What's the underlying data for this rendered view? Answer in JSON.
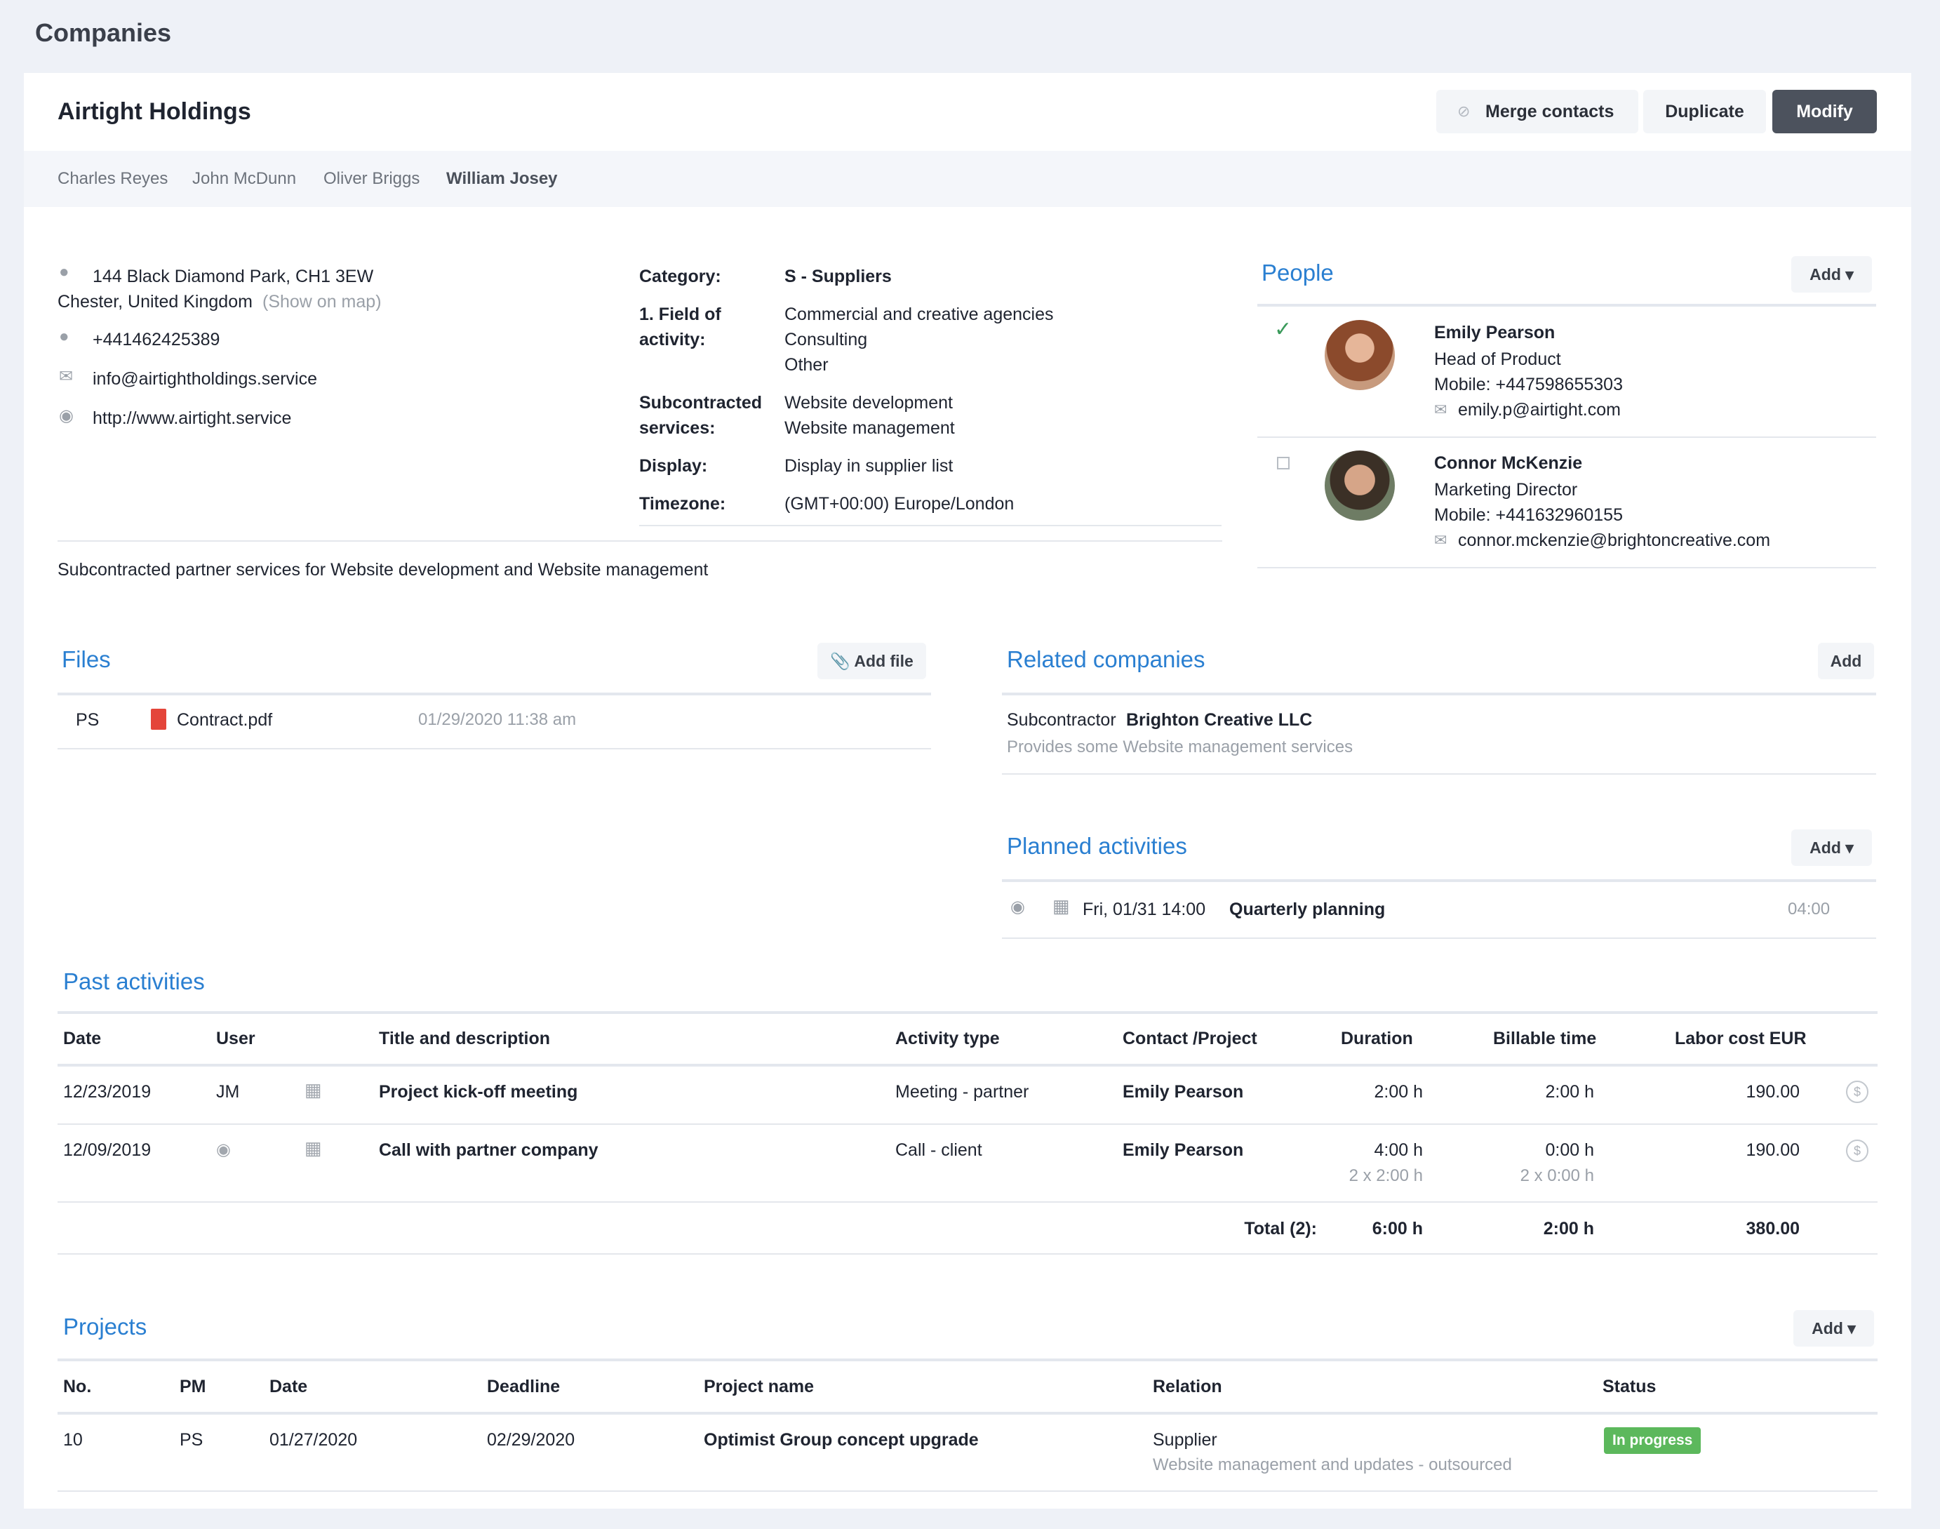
{
  "page": {
    "title": "Companies"
  },
  "company": {
    "name": "Airtight Holdings",
    "actions": {
      "merge": "Merge contacts",
      "duplicate": "Duplicate",
      "modify": "Modify"
    },
    "contacts": [
      "Charles Reyes",
      "John McDunn",
      "Oliver Briggs",
      "William Josey"
    ],
    "active_contact": "William Josey"
  },
  "info": {
    "address_line1": "144 Black Diamond Park, CH1 3EW",
    "address_line2": "Chester, United Kingdom",
    "show_on_map": "(Show on map)",
    "phone": "+441462425389",
    "email": "info@airtightholdings.service",
    "website": "http://www.airtight.service",
    "description": "Subcontracted partner services for Website development and Website management"
  },
  "details": {
    "category_label": "Category:",
    "category_value": "S - Suppliers",
    "field_label_1": "1. Field of",
    "field_label_2": "activity:",
    "field_values": [
      "Commercial and creative agencies",
      "Consulting",
      "Other"
    ],
    "sub_label_1": "Subcontracted",
    "sub_label_2": "services:",
    "sub_values": [
      "Website development",
      "Website management"
    ],
    "display_label": "Display:",
    "display_value": "Display in supplier list",
    "timezone_label": "Timezone:",
    "timezone_value": "(GMT+00:00) Europe/London"
  },
  "people": {
    "title": "People",
    "add_label": "Add",
    "list": [
      {
        "name": "Emily Pearson",
        "role": "Head of Product",
        "mobile": "Mobile: +447598655303",
        "email": "emily.p@airtight.com",
        "checked": true
      },
      {
        "name": "Connor McKenzie",
        "role": "Marketing Director",
        "mobile": "Mobile: +441632960155",
        "email": "connor.mckenzie@brightoncreative.com",
        "checked": false
      }
    ]
  },
  "files": {
    "title": "Files",
    "add_label": "Add file",
    "list": [
      {
        "user": "PS",
        "name": "Contract.pdf",
        "date": "01/29/2020 11:38 am"
      }
    ]
  },
  "related": {
    "title": "Related companies",
    "add_label": "Add",
    "relation": "Subcontractor",
    "company": "Brighton Creative LLC",
    "note": "Provides some Website management services"
  },
  "planned": {
    "title": "Planned activities",
    "add_label": "Add",
    "date": "Fri, 01/31 14:00",
    "name": "Quarterly planning",
    "duration": "04:00"
  },
  "past": {
    "title": "Past activities",
    "headers": [
      "Date",
      "User",
      "Title and description",
      "Activity type",
      "Contact /Project",
      "Duration",
      "Billable time",
      "Labor cost EUR"
    ],
    "rows": [
      {
        "date": "12/23/2019",
        "user": "JM",
        "title": "Project kick-off meeting",
        "type": "Meeting - partner",
        "contact": "Emily Pearson",
        "duration": "2:00 h",
        "duration_sub": "",
        "billable": "2:00 h",
        "billable_sub": "",
        "cost": "190.00"
      },
      {
        "date": "12/09/2019",
        "user": "",
        "title": "Call with partner company",
        "type": "Call - client",
        "contact": "Emily Pearson",
        "duration": "4:00 h",
        "duration_sub": "2 x 2:00 h",
        "billable": "0:00 h",
        "billable_sub": "2 x 0:00 h",
        "cost": "190.00"
      }
    ],
    "total_label": "Total (2):",
    "total_duration": "6:00 h",
    "total_billable": "2:00 h",
    "total_cost": "380.00"
  },
  "projects": {
    "title": "Projects",
    "add_label": "Add",
    "headers": [
      "No.",
      "PM",
      "Date",
      "Deadline",
      "Project name",
      "Relation",
      "Status"
    ],
    "rows": [
      {
        "no": "10",
        "pm": "PS",
        "date": "01/27/2020",
        "deadline": "02/29/2020",
        "name": "Optimist Group concept upgrade",
        "relation": "Supplier",
        "relation_note": "Website management and updates - outsourced",
        "status": "In progress"
      }
    ]
  },
  "colors": {
    "accent": "#2a7fd1",
    "status_green": "#5cb85c",
    "primary_button": "#4c525d"
  }
}
